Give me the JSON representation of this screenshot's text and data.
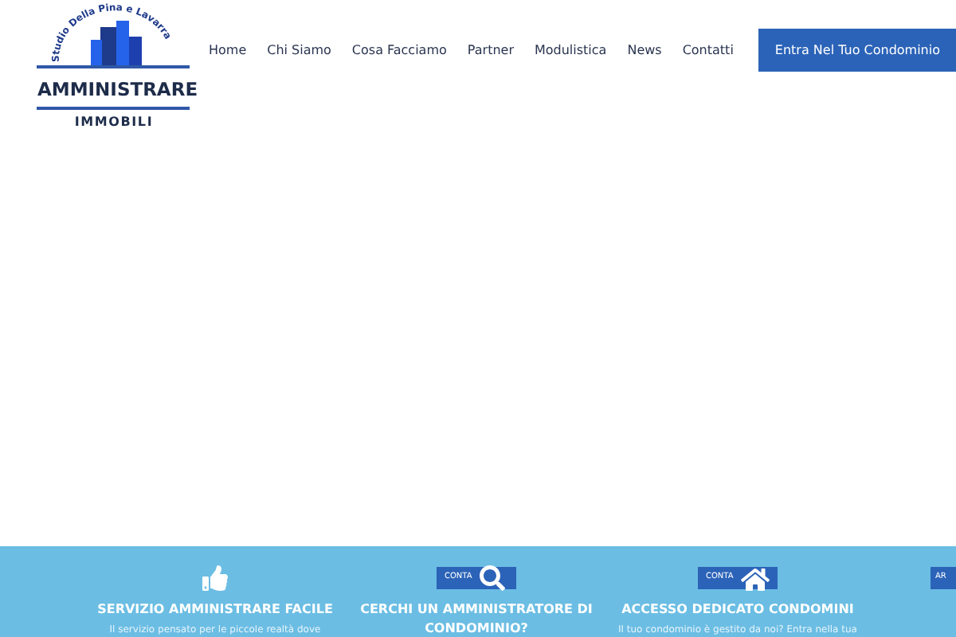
{
  "logo": {
    "arc_text": "Studio Della Pina e Lavarra",
    "name": "AMMINISTRARE",
    "subtitle": "IMMOBILI"
  },
  "nav": {
    "items": [
      {
        "label": "Home"
      },
      {
        "label": "Chi Siamo"
      },
      {
        "label": "Cosa Facciamo"
      },
      {
        "label": "Partner"
      },
      {
        "label": "Modulistica"
      },
      {
        "label": "News"
      },
      {
        "label": "Contatti"
      }
    ],
    "cta": "Entra Nel Tuo Condominio"
  },
  "features": [
    {
      "kind": "thumbs",
      "title": "SERVIZIO AMMINISTRARE FACILE",
      "text": "Il servizio pensato per le piccole realtà dove"
    },
    {
      "kind": "search",
      "button": "CONTA",
      "title": "CERCHI UN AMMINISTRATORE DI CONDOMINIO?"
    },
    {
      "kind": "house",
      "button": "CONTA",
      "title": "ACCESSO DEDICATO CONDOMINI",
      "text": "Il tuo condominio è gestito da noi? Entra nella tua"
    },
    {
      "kind": "plain",
      "button": "AR"
    }
  ]
}
